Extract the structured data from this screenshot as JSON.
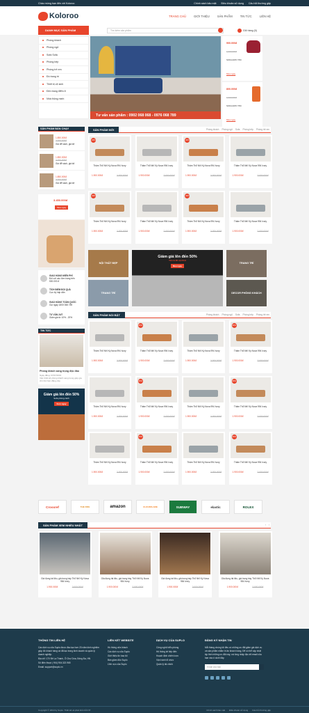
{
  "topbar": {
    "welcome": "Chào mừng bạn đến với Koloroo",
    "links": [
      "Chính sách bảo mật",
      "Điều khoản sử dụng",
      "Câu hỏi thường gặp"
    ]
  },
  "header": {
    "logo": "Koloroo",
    "nav": [
      "TRANG CHỦ",
      "GIỚI THIỆU",
      "SẢN PHẨM",
      "TIN TỨC",
      "LIÊN HỆ"
    ]
  },
  "searchbar": {
    "category_button": "DANH MỤC SẢN PHẨM",
    "placeholder": "Tìm kiếm sản phẩm",
    "cart": "Giỏ hàng (0)"
  },
  "categories": [
    "Phòng khách",
    "Phòng ngủ",
    "Sofa Sofa",
    "Phòng bếp",
    "Phòng trẻ em",
    "Đồ trang trí",
    "Thiết bị vệ sinh",
    "Đèn trang điểm 8",
    "Nhà thông minh"
  ],
  "hero": {
    "phone": "Tư vấn sản phẩm : 0902 068 068 - 0976 068 789"
  },
  "side_ads": [
    {
      "price": "900.000đ",
      "old": "1.200.000đ",
      "label": "SOFA ĐƠN TIM",
      "link": "Mua ngay"
    },
    {
      "price": "800.000đ",
      "old": "1.200.000đ",
      "label": "SOFA ĐƠN TIM",
      "link": "Mua ngay"
    }
  ],
  "bestseller": {
    "title": "SẢN PHẨM BÁN CHẠY",
    "items": [
      {
        "price": "1.850.000đ",
        "old": "2.000.000đ",
        "name": "Giá để sách, giá kệ"
      },
      {
        "price": "1.850.000đ",
        "old": "2.000.000đ",
        "name": "Giá để sách, giá kệ"
      },
      {
        "price": "1.850.000đ",
        "old": "2.000.000đ",
        "name": "Giá để sách, giá kệ"
      }
    ]
  },
  "promo": {
    "text": "3.450.000đ",
    "button": "Mua ngay"
  },
  "services": [
    {
      "title": "GIAO HÀNG MIỄN PHÍ",
      "desc": "Đối với các đơn hàng trên 500.000 đ"
    },
    {
      "title": "TÍCH ĐIỂM ĐỔI QUÀ",
      "desc": "Cực kỳ hấp dẫn"
    },
    {
      "title": "GIAO HÀNG TOÀN QUỐC",
      "desc": "Gọi ngay 1800 068 789"
    },
    {
      "title": "TƯ VẤN 24/7",
      "desc": "Giảm giá từ 10% - 20%"
    }
  ],
  "news": {
    "title": "TIN TỨC",
    "head": "TIN TỨC",
    "item": "Phòng khách sang trọng độc đáo",
    "date": "Ngày đăng: 07/07/2019",
    "desc": "Việc thiết kế phòng khách sang trọng giúp gia chủ thể hiện đẳng cấp."
  },
  "sale_banner": {
    "title": "Giảm giá lên đến 50%",
    "sub": "Sofa phòng cách",
    "button": "Xem ngay"
  },
  "new_products": {
    "title": "SẢN PHẨM MỚI",
    "tabs": [
      "Phòng khách",
      "Phòng ngủ",
      "Sofa",
      "Phòng bếp",
      "Phòng trẻ em"
    ]
  },
  "featured": {
    "title": "SẢN PHẨM NỔI BẬT",
    "tabs": [
      "Phòng khách",
      "Phòng ngủ",
      "Sofa",
      "Phòng bếp",
      "Phòng trẻ em"
    ]
  },
  "product": {
    "name": "Thảm Thổ Nhĩ Kỳ Nova 994 Ivory",
    "price": "1.900.000đ",
    "old": "2.000.000đ",
    "badge": "-30%"
  },
  "banners": {
    "left_top": "NỘI THẤT ĐẸP",
    "center": "Giảm giá lên đến 50%",
    "center_sub": "Tất cả đồ nội thất",
    "center_btn": "Mua ngay",
    "left_bottom": "TRANG TRÍ",
    "right_top": "TRANG TRÍ",
    "right_bottom": "DECOR PHÒNG KHÁCH"
  },
  "partners": [
    "Crossref",
    "THE FIRE",
    "amazon",
    "CLOUDFLARE",
    "SUBWAY",
    "elastic",
    "ROLEX"
  ],
  "viewed": {
    "title": "SẢN PHẨM XEM NHIỀU NHẤT",
    "name": "Giá đựng tài liệu, giá trong bày Thổ Nhĩ Kỳ Nova 984 Ivory",
    "price": "1.900.000đ",
    "old": "2.000.000đ"
  },
  "footer": {
    "c1_title": "THÔNG TIN LIÊN HỆ",
    "c1_text": "Các dịch vụ của Suplo được đào tạo hơn 20 năm kinh nghiệm giúp đồ khách hàng và đã tạo trong kinh doanh và quản lý doanh nghiệp.",
    "c1_addr": "Địa chỉ: 170 Đê La Thành, Ô Chợ Dừa, Đống Đa, HN",
    "c1_phone": "Số điện thoại: (+84) 904.322.965",
    "c1_email": "Email: support@suplo.vn",
    "c2_title": "LIÊN KẾT WEBSITE",
    "c2_items": [
      "Hồ thống cửa khách",
      "Các dịch vụ của Suplo",
      "Giới thiệu tin bao tôi",
      "Bán giám đốc Suplo",
      "Lĩnh vực của Suplo"
    ],
    "c3_title": "DỊCH VỤ CỦA SUPLO",
    "c3_items": [
      "Công nghệ biểu phòng",
      "Hệ thống kế tiếp đến",
      "Hoạch định chiến lược",
      "Vận hành tổ chức",
      "Quản lý tài chính"
    ],
    "c4_title": "ĐĂNG KÝ NHẬN TIN",
    "c4_text": "Mỗi tháng chúng tôi đều có những ưu đãi giảm giá dịch vụ và sản phẩm nhằm tri ân khách hàng. Để có thể cập nhật kịp thời những ưu đãi này, vui lòng nhập địa chỉ email của bạn vào ô dưới đây.",
    "c4_placeholder": "Email của bạn",
    "copyright": "Copyright © 2019 by Suplo. Thiết kế và phát triển bởi NT",
    "bottom_links": [
      "Chính sách bảo mật",
      "Điều khoản sử dụng",
      "Câu hỏi thường gặp"
    ]
  }
}
